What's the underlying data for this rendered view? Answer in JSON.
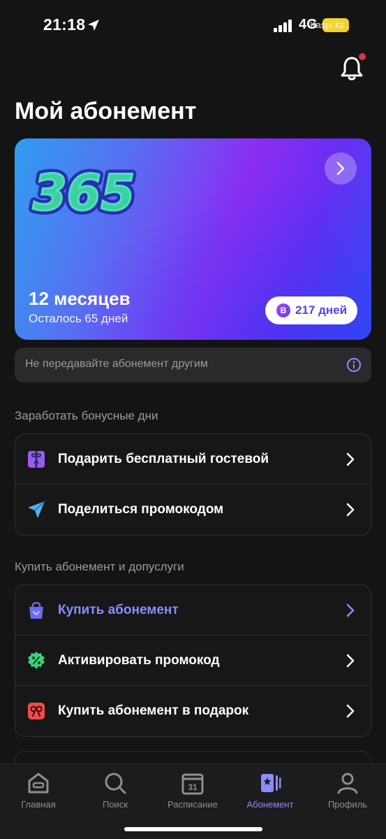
{
  "status_bar": {
    "time": "21:18",
    "network": "4G",
    "watermark": "Kaspi.kz"
  },
  "page": {
    "title": "Мой абонемент"
  },
  "subscription_card": {
    "logo_text": "365",
    "title": "12 месяцев",
    "subtitle": "Осталось 65 дней",
    "badge_letter": "B",
    "badge_text": "217 дней"
  },
  "notice": {
    "text": "Не передавайте абонемент другим"
  },
  "bonus_section": {
    "label": "Заработать бонусные дни",
    "items": [
      {
        "label": "Подарить бесплатный гостевой",
        "icon": "gift-icon"
      },
      {
        "label": "Поделиться промокодом",
        "icon": "send-icon"
      }
    ]
  },
  "buy_section": {
    "label": "Купить абонемент и допуслуги",
    "items": [
      {
        "label": "Купить абонемент",
        "icon": "shopping-bag-icon"
      },
      {
        "label": "Активировать промокод",
        "icon": "percent-badge-icon"
      },
      {
        "label": "Купить абонемент в подарок",
        "icon": "bow-icon"
      }
    ]
  },
  "tab_bar": {
    "items": [
      {
        "label": "Главная",
        "icon": "home-icon"
      },
      {
        "label": "Поиск",
        "icon": "search-icon"
      },
      {
        "label": "Расписание",
        "icon": "calendar-icon",
        "day": "31"
      },
      {
        "label": "Абонемент",
        "icon": "membership-icon",
        "active": true
      },
      {
        "label": "Профиль",
        "icon": "profile-icon"
      }
    ]
  },
  "colors": {
    "accent": "#8a8cff",
    "background": "#141414",
    "notification": "#e0324b"
  }
}
